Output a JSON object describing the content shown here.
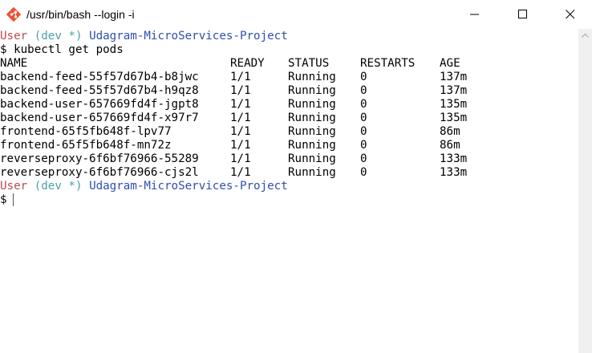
{
  "window": {
    "title": "/usr/bin/bash --login -i",
    "icon": "git-diamond-icon",
    "accent": "#f05133"
  },
  "prompt": {
    "user": "User",
    "branch": "(dev *)",
    "path": "Udagram-MicroServices-Project",
    "symbol": "$",
    "colors": {
      "user": "#bf4b50",
      "branch": "#4b9faf",
      "path": "#2f4fb0"
    }
  },
  "command": "kubectl get pods",
  "table": {
    "headers": [
      "NAME",
      "READY",
      "STATUS",
      "RESTARTS",
      "AGE"
    ],
    "rows": [
      [
        "backend-feed-55f57d67b4-b8jwc",
        "1/1",
        "Running",
        "0",
        "137m"
      ],
      [
        "backend-feed-55f57d67b4-h9qz8",
        "1/1",
        "Running",
        "0",
        "137m"
      ],
      [
        "backend-user-657669fd4f-jgpt8",
        "1/1",
        "Running",
        "0",
        "135m"
      ],
      [
        "backend-user-657669fd4f-x97r7",
        "1/1",
        "Running",
        "0",
        "135m"
      ],
      [
        "frontend-65f5fb648f-lpv77",
        "1/1",
        "Running",
        "0",
        "86m"
      ],
      [
        "frontend-65f5fb648f-mn72z",
        "1/1",
        "Running",
        "0",
        "86m"
      ],
      [
        "reverseproxy-6f6bf76966-55289",
        "1/1",
        "Running",
        "0",
        "133m"
      ],
      [
        "reverseproxy-6f6bf76966-cjs2l",
        "1/1",
        "Running",
        "0",
        "133m"
      ]
    ]
  }
}
